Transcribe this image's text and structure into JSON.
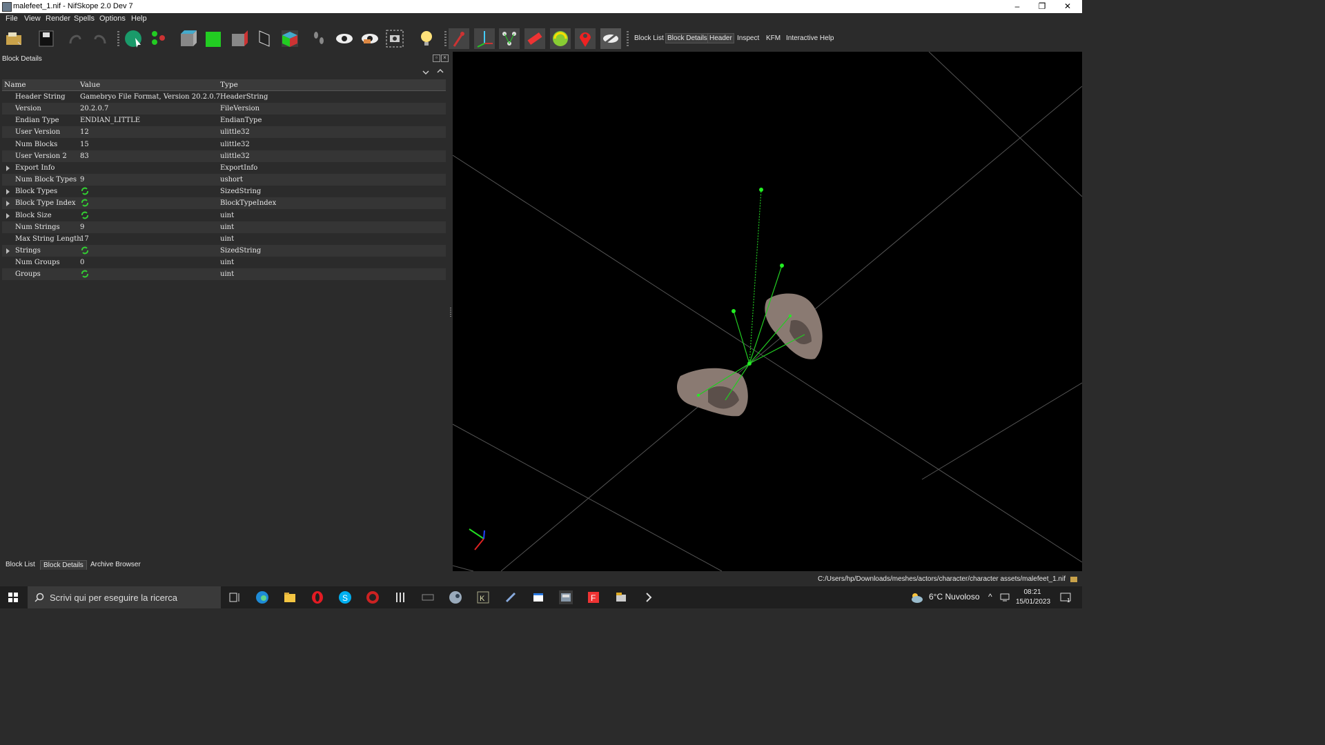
{
  "window": {
    "title": "malefeet_1.nif - NifSkope 2.0 Dev 7",
    "minimize": "–",
    "restore": "❐",
    "close": "✕"
  },
  "menu": [
    "File",
    "View",
    "Render",
    "Spells",
    "Options",
    "Help"
  ],
  "toolbar": {
    "text_buttons": [
      "Block List",
      "Block Details",
      "Header",
      "Inspect",
      "KFM",
      "Interactive Help"
    ]
  },
  "panel": {
    "title": "Block Details",
    "columns": [
      "Name",
      "Value",
      "Type"
    ],
    "rows": [
      {
        "name": "Header String",
        "value": "Gamebryo File Format, Version 20.2.0.7",
        "type": "HeaderString",
        "expandable": false,
        "link": false
      },
      {
        "name": "Version",
        "value": "20.2.0.7",
        "type": "FileVersion",
        "expandable": false,
        "link": false
      },
      {
        "name": "Endian Type",
        "value": "ENDIAN_LITTLE",
        "type": "EndianType",
        "expandable": false,
        "link": false
      },
      {
        "name": "User Version",
        "value": "12",
        "type": "ulittle32",
        "expandable": false,
        "link": false
      },
      {
        "name": "Num Blocks",
        "value": "15",
        "type": "ulittle32",
        "expandable": false,
        "link": false
      },
      {
        "name": "User Version 2",
        "value": "83",
        "type": "ulittle32",
        "expandable": false,
        "link": false
      },
      {
        "name": "Export Info",
        "value": "",
        "type": "ExportInfo",
        "expandable": true,
        "link": false
      },
      {
        "name": "Num Block Types",
        "value": "9",
        "type": "ushort",
        "expandable": false,
        "link": false
      },
      {
        "name": "Block Types",
        "value": "",
        "type": "SizedString",
        "expandable": true,
        "link": true
      },
      {
        "name": "Block Type Index",
        "value": "",
        "type": "BlockTypeIndex",
        "expandable": true,
        "link": true
      },
      {
        "name": "Block Size",
        "value": "",
        "type": "uint",
        "expandable": true,
        "link": true
      },
      {
        "name": "Num Strings",
        "value": "9",
        "type": "uint",
        "expandable": false,
        "link": false
      },
      {
        "name": "Max String Length",
        "value": "17",
        "type": "uint",
        "expandable": false,
        "link": false
      },
      {
        "name": "Strings",
        "value": "",
        "type": "SizedString",
        "expandable": true,
        "link": true
      },
      {
        "name": "Num Groups",
        "value": "0",
        "type": "uint",
        "expandable": false,
        "link": false
      },
      {
        "name": "Groups",
        "value": "",
        "type": "uint",
        "expandable": false,
        "link": true
      }
    ]
  },
  "bottom_tabs": [
    "Block List",
    "Block Details",
    "Archive Browser"
  ],
  "status": {
    "path": "C:/Users/hp/Downloads/meshes/actors/character/character assets/malefeet_1.nif"
  },
  "taskbar": {
    "search_placeholder": "Scrivi qui per eseguire la ricerca",
    "weather": "6°C  Nuvoloso",
    "time": "08:21",
    "date": "15/01/2023",
    "notifications": "1"
  },
  "colors": {
    "accent_green": "#22dd22",
    "bg": "#2b2b2b",
    "viewport": "#000000"
  }
}
